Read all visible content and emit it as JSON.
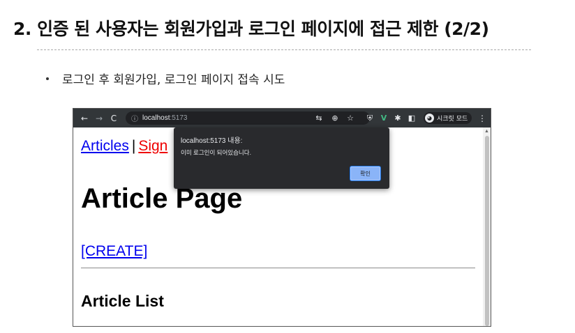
{
  "slide": {
    "title": "2. 인증 된 사용자는 회원가입과 로그인 페이지에 접근 제한 (2/2)",
    "bullet": "로그인 후 회원가입, 로그인 페이지 접속 시도"
  },
  "browser": {
    "address": {
      "host": "localhost",
      "port": ":5173"
    },
    "nav_icons": [
      "back-icon",
      "forward-icon",
      "reload-icon",
      "info-icon"
    ],
    "ext_icons": [
      "translate-icon",
      "zoom-icon",
      "bookmark-star-icon",
      "shield-icon",
      "vue-devtools-icon",
      "extensions-icon",
      "sidepanel-icon"
    ],
    "incognito_label": "시크릿 모드",
    "colors": {
      "toolbar": "#323639",
      "dialog_bg": "#292a2d",
      "ok_button": "#8ab4f8",
      "vue_green": "#42b883"
    }
  },
  "page": {
    "nav_articles": "Articles",
    "nav_sep": "|",
    "nav_signup_partial": "Sign",
    "heading": "Article Page",
    "create_link": "[CREATE]",
    "list_heading": "Article List"
  },
  "dialog": {
    "title": "localhost:5173 내용:",
    "message": "이미 로그인이 되어있습니다.",
    "ok_label": "확인"
  }
}
